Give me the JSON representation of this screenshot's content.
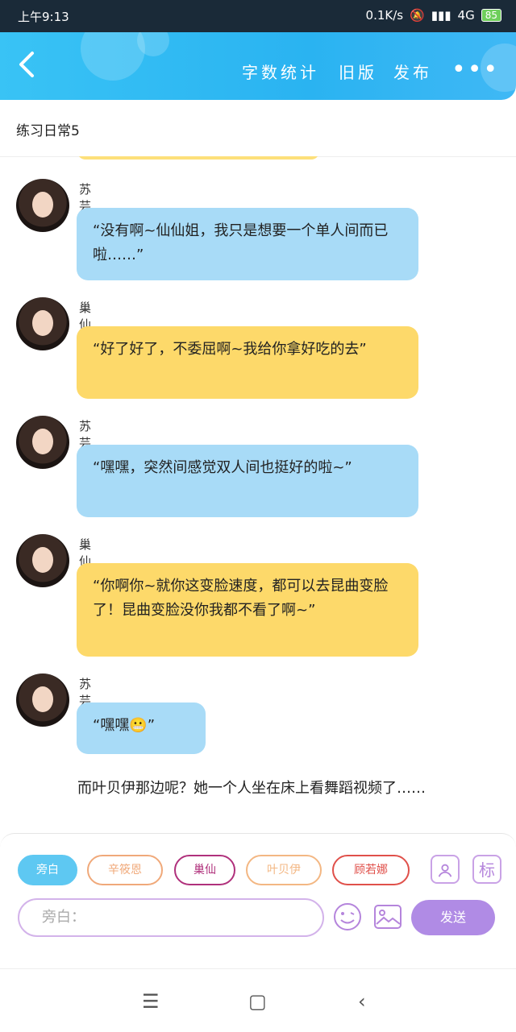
{
  "status_bar": {
    "time": "上午9:13",
    "network_speed": "0.1K/s",
    "network": "4G",
    "battery": "85"
  },
  "header": {
    "nav_items": [
      "字数统计",
      "旧版",
      "发布"
    ],
    "more": "•••"
  },
  "title": "练习日常5",
  "messages": [
    {
      "sender": "苏芸乐",
      "text": "“没有啊~仙仙姐，我只是想要一个单人间而已啦……”",
      "color": "blue"
    },
    {
      "sender": "巢仙",
      "text": "“好了好了，不委屈啊~我给你拿好吃的去”",
      "color": "yellow"
    },
    {
      "sender": "苏芸乐",
      "text": "“嘿嘿，突然间感觉双人间也挺好的啦~”",
      "color": "blue"
    },
    {
      "sender": "巢仙",
      "text": "“你啊你~就你这变脸速度，都可以去昆曲变脸了！昆曲变脸没你我都不看了啊~”",
      "color": "yellow"
    },
    {
      "sender": "苏芸乐",
      "text": "“嘿嘿😬”",
      "color": "blue"
    }
  ],
  "narration": "而叶贝伊那边呢？她一个人坐在床上看舞蹈视频了……",
  "bottom": {
    "chips": [
      {
        "label": "旁白",
        "color": "#5ec8f2",
        "active": true
      },
      {
        "label": "辛筱恩",
        "color": "#f0a97a",
        "active": false
      },
      {
        "label": "巢仙",
        "color": "#b0317c",
        "active": false
      },
      {
        "label": "叶贝伊",
        "color": "#f3b783",
        "active": false
      },
      {
        "label": "顾若娜",
        "color": "#e0504a",
        "active": false
      }
    ],
    "tag_icon_label": "标",
    "input_placeholder": "旁白：",
    "send_label": "发送"
  }
}
